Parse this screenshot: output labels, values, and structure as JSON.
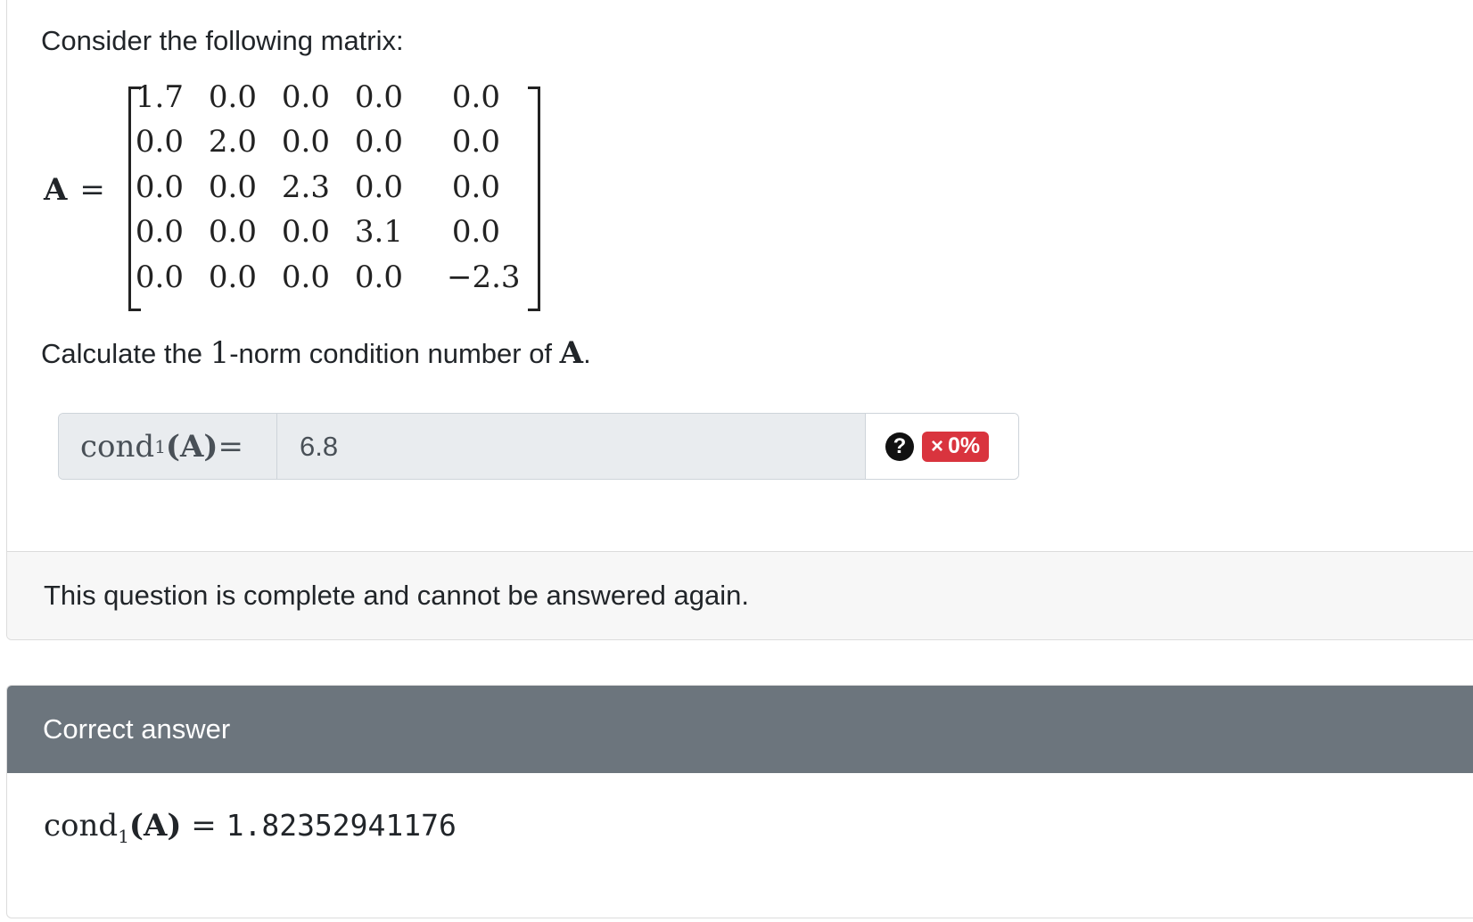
{
  "question": {
    "intro": "Consider the following matrix:",
    "matrix_symbol": "A",
    "equals": "=",
    "matrix": [
      [
        "1.7",
        "0.0",
        "0.0",
        "0.0",
        "0.0"
      ],
      [
        "0.0",
        "2.0",
        "0.0",
        "0.0",
        "0.0"
      ],
      [
        "0.0",
        "0.0",
        "2.3",
        "0.0",
        "0.0"
      ],
      [
        "0.0",
        "0.0",
        "0.0",
        "3.1",
        "0.0"
      ],
      [
        "0.0",
        "0.0",
        "0.0",
        "0.0",
        "−2.3"
      ]
    ],
    "task_prefix": "Calculate the ",
    "task_number": "1",
    "task_middle": "-norm condition number of ",
    "task_symbol": "A",
    "task_suffix": "."
  },
  "answer_input": {
    "label_func": "cond",
    "label_sub": "1",
    "label_arg": "(A)",
    "label_eq": " =",
    "value": "6.8",
    "help_symbol": "?",
    "score_icon": "×",
    "score": "0%",
    "score_color": "#d9343e"
  },
  "footer": {
    "status": "This question is complete and cannot be answered again."
  },
  "correct_answer": {
    "header": "Correct answer",
    "func": "cond",
    "sub": "1",
    "arg": "(A)",
    "eq": " = ",
    "value": "1.82352941176"
  },
  "icons": {
    "help": "help-icon",
    "incorrect": "x-icon"
  }
}
